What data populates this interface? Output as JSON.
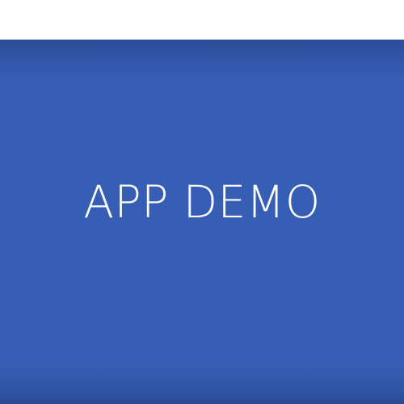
{
  "app": {
    "title": "APP DEMO"
  },
  "colors": {
    "banner": "#365eb4",
    "text": "#ffffff",
    "background": "#ffffff"
  }
}
